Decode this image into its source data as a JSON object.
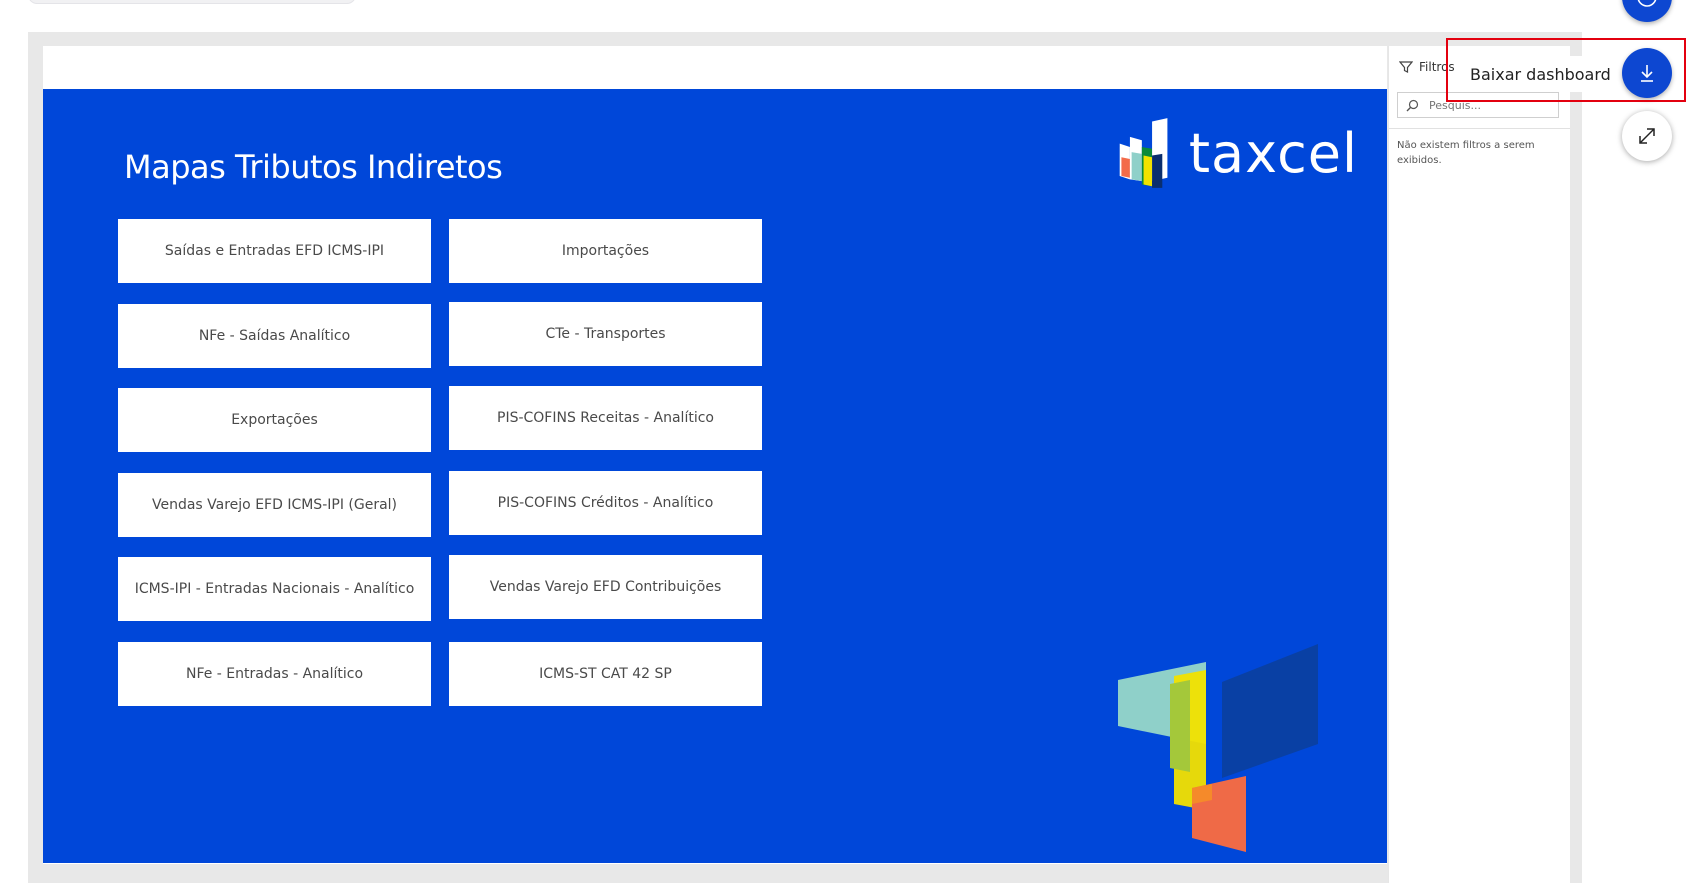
{
  "report": {
    "title": "Mapas Tributos Indiretos",
    "logo_text": "taxcel",
    "buttons_col1": [
      "Saídas e Entradas EFD ICMS-IPI",
      "NFe - Saídas Analítico",
      "Exportações",
      "Vendas Varejo EFD ICMS-IPI (Geral)",
      "ICMS-IPI - Entradas Nacionais - Analítico",
      "NFe - Entradas - Analítico"
    ],
    "buttons_col2": [
      "Importações",
      "CTe - Transportes",
      "PIS-COFINS Receitas - Analítico",
      "PIS-COFINS Créditos - Analítico",
      "Vendas Varejo EFD Contribuições",
      "ICMS-ST CAT 42 SP"
    ]
  },
  "filters": {
    "title": "Filtros",
    "search_placeholder": "Pesquis...",
    "empty_message": "Não existem filtros a serem exibidos."
  },
  "actions": {
    "download_tooltip": "Baixar dashboard"
  },
  "colors": {
    "panel_blue": "#0047d9",
    "fab_blue": "#0d47d1",
    "highlight_red": "#e3000f"
  }
}
